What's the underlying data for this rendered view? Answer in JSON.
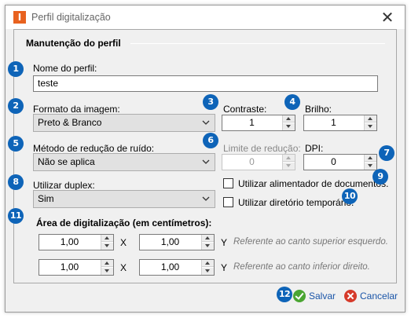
{
  "window": {
    "title": "Perfil digitalização",
    "app_icon": "I"
  },
  "section": {
    "title": "Manutenção do perfil"
  },
  "profile_name": {
    "label": "Nome do perfil:",
    "value": "teste"
  },
  "image_format": {
    "label": "Formato da imagem:",
    "selected": "Preto & Branco"
  },
  "contrast": {
    "label": "Contraste:",
    "value": "1"
  },
  "brightness": {
    "label": "Brilho:",
    "value": "1"
  },
  "noise_method": {
    "label": "Método de redução de ruído:",
    "selected": "Não se aplica"
  },
  "reduction_limit": {
    "label": "Limite de redução:",
    "value": "0"
  },
  "dpi": {
    "label": "DPI:",
    "value": "0"
  },
  "duplex": {
    "label": "Utilizar duplex:",
    "selected": "Sim"
  },
  "feeder": {
    "label": "Utilizar alimentador de documentos.",
    "checked": false
  },
  "temp_dir": {
    "label": "Utilizar diretório temporário.",
    "checked": false
  },
  "area": {
    "title": "Área de digitalização (em centímetros):",
    "rows": [
      {
        "x": "1,00",
        "x_sep": "X",
        "y": "1,00",
        "y_sep": "Y",
        "hint": "Referente ao canto superior esquerdo."
      },
      {
        "x": "1,00",
        "x_sep": "X",
        "y": "1,00",
        "y_sep": "Y",
        "hint": "Referente ao canto inferior direito."
      }
    ]
  },
  "buttons": {
    "save": "Salvar",
    "cancel": "Cancelar"
  },
  "badges": [
    "1",
    "2",
    "3",
    "4",
    "5",
    "6",
    "7",
    "8",
    "9",
    "10",
    "11",
    "12"
  ],
  "colors": {
    "badge": "#0e64b8",
    "link": "#1a55a8",
    "app_icon": "#e8621f"
  }
}
